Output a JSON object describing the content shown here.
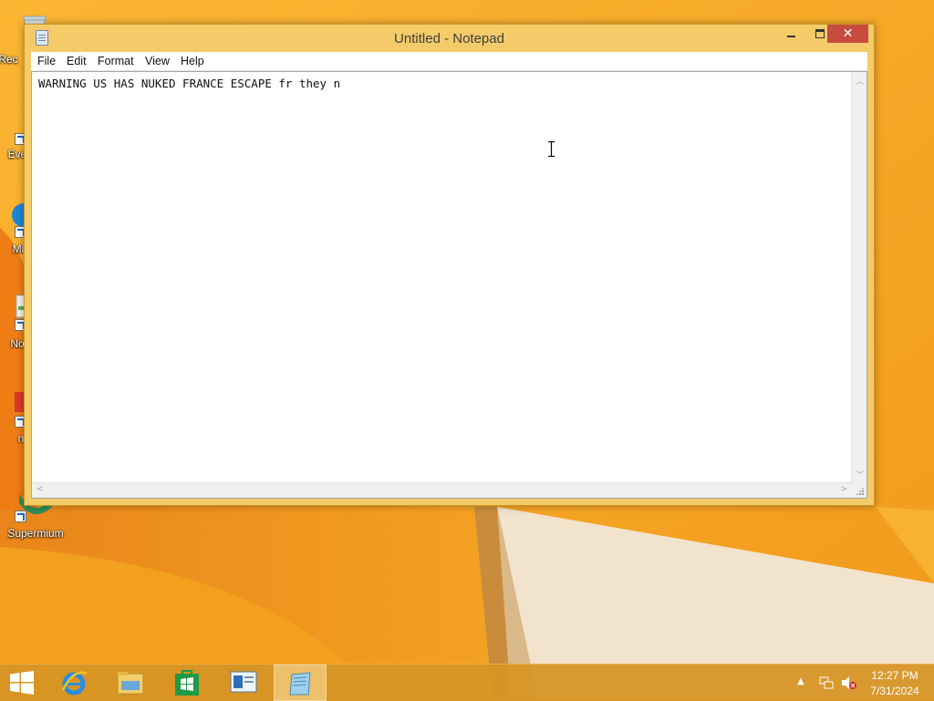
{
  "desktop": {
    "icons": [
      {
        "label": "Rec",
        "icon": "recycle-bin-icon"
      },
      {
        "label": "Eve",
        "icon": "shortcut-app-icon"
      },
      {
        "label": "Mi",
        "icon": "edge-browser-icon"
      },
      {
        "label": "No",
        "icon": "notepad-shortcut-icon"
      },
      {
        "label": "n",
        "icon": "red-app-shortcut-icon"
      },
      {
        "label": "Supermium",
        "icon": "supermium-browser-icon"
      }
    ]
  },
  "notepad": {
    "title": "Untitled - Notepad",
    "close_glyph": "✕",
    "menu": [
      "File",
      "Edit",
      "Format",
      "View",
      "Help"
    ],
    "content": "WARNING US HAS NUKED FRANCE ESCAPE fr they n"
  },
  "taskbar": {
    "items": [
      {
        "icon": "start-windows-icon"
      },
      {
        "icon": "internet-explorer-icon"
      },
      {
        "icon": "file-explorer-icon"
      },
      {
        "icon": "windows-store-icon"
      },
      {
        "icon": "remote-desktop-icon"
      },
      {
        "icon": "notepad-icon",
        "active": true
      }
    ],
    "clock": {
      "time": "12:27 PM",
      "date": "7/31/2024"
    }
  },
  "colors": {
    "wallpaper_base": "#f7a824",
    "window_frame": "#f4cb68",
    "close_button": "#c74c3f",
    "taskbar": "#d69424"
  }
}
